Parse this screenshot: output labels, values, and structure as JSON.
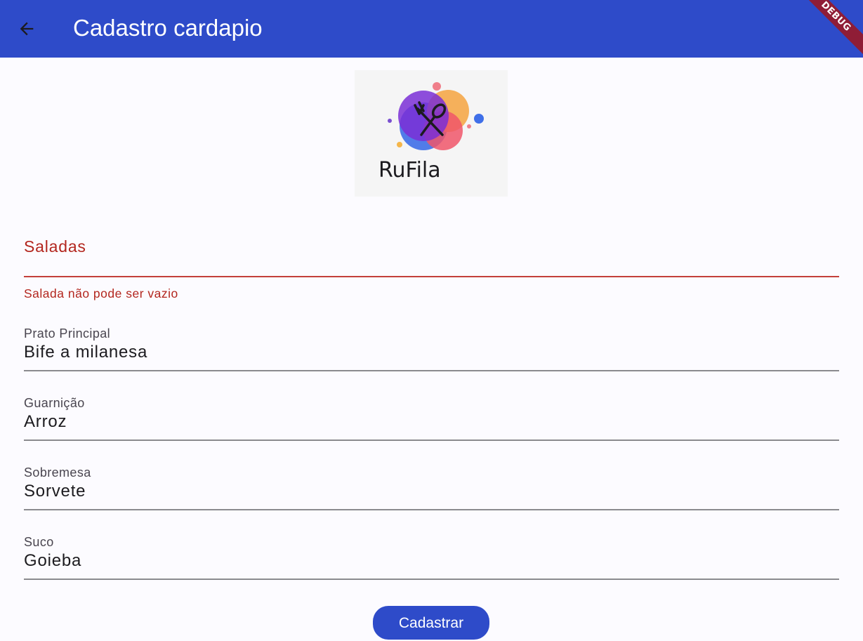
{
  "appbar": {
    "title": "Cadastro cardapio",
    "back_icon": "arrow-back-icon",
    "color": "#2e4bc9",
    "debug_banner": "DEBUG"
  },
  "logo": {
    "text": "RuFila"
  },
  "form": {
    "salad": {
      "label": "Saladas",
      "value": "",
      "error": "Salada não pode ser vazio"
    },
    "main_dish": {
      "label": "Prato Principal",
      "value": "Bife a milanesa"
    },
    "side_dish": {
      "label": "Guarnição",
      "value": "Arroz"
    },
    "dessert": {
      "label": "Sobremesa",
      "value": "Sorvete"
    },
    "juice": {
      "label": "Suco",
      "value": "Goieba"
    },
    "submit_label": "Cadastrar"
  },
  "colors": {
    "error": "#b3261e",
    "primary": "#2e4bc9"
  }
}
